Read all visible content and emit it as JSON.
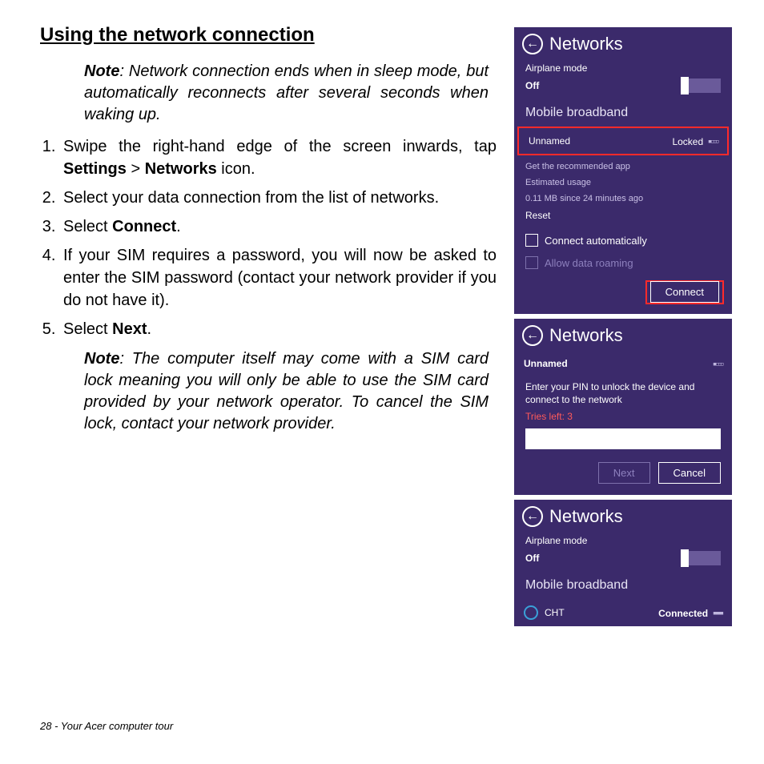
{
  "heading": "Using the network connection",
  "note1_label": "Note",
  "note1_text": ": Network connection ends when in sleep mode, but automatically reconnects after several seconds when waking up.",
  "steps": {
    "s1a": "Swipe the right-hand edge of the screen inwards, tap ",
    "s1b": "Settings",
    "s1c": " > ",
    "s1d": "Networks",
    "s1e": " icon.",
    "s2": "Select your data connection from the list of networks.",
    "s3a": "Select ",
    "s3b": "Connect",
    "s3c": ".",
    "s4": "If your SIM requires a password, you will now be asked to enter the SIM password (contact your network provider if you do not have it).",
    "s5a": "Select ",
    "s5b": "Next",
    "s5c": "."
  },
  "note2_label": "Note",
  "note2_text": ": The computer itself may come with a SIM card lock meaning you will only be able to use the SIM card provided by your network operator. To cancel the SIM lock, contact your network provider.",
  "footer": "28 - Your Acer computer tour",
  "panel1": {
    "title": "Networks",
    "airplane_label": "Airplane mode",
    "airplane_state": "Off",
    "section": "Mobile broadband",
    "net_name": "Unnamed",
    "net_status": "Locked",
    "rec_app": "Get the recommended app",
    "est_label": "Estimated usage",
    "est_value": "0.11 MB since 24 minutes ago",
    "reset": "Reset",
    "auto": "Connect automatically",
    "roam": "Allow data roaming",
    "connect": "Connect"
  },
  "panel2": {
    "title": "Networks",
    "net_name": "Unnamed",
    "prompt": "Enter your PIN to unlock the device and connect to the network",
    "tries": "Tries left: 3",
    "next": "Next",
    "cancel": "Cancel"
  },
  "panel3": {
    "title": "Networks",
    "airplane_label": "Airplane mode",
    "airplane_state": "Off",
    "section": "Mobile broadband",
    "net_name": "CHT",
    "net_status": "Connected"
  }
}
